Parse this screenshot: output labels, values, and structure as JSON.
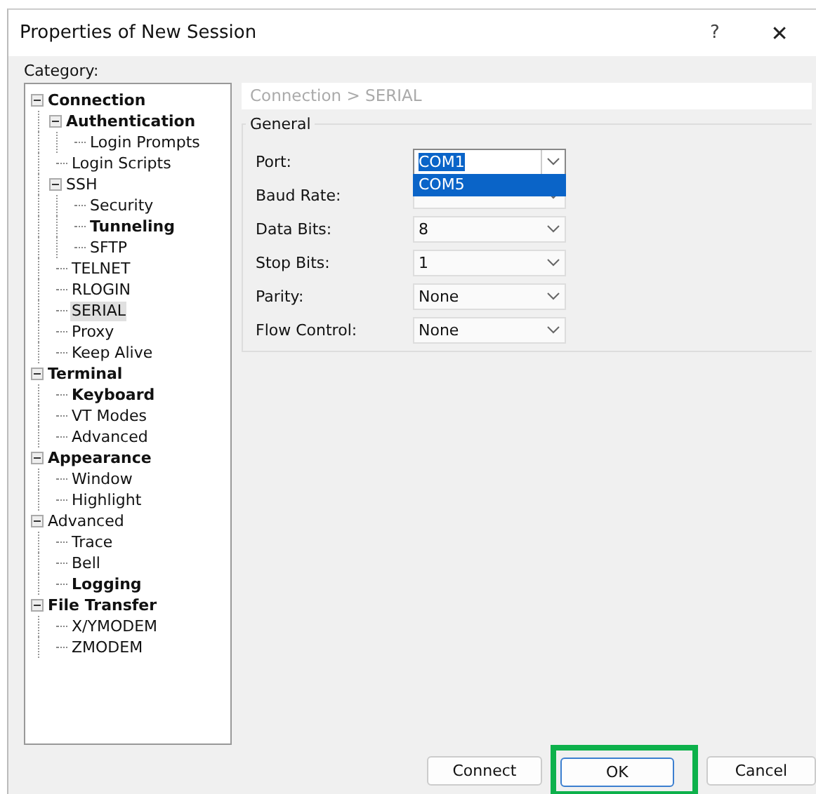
{
  "window": {
    "title": "Properties of New Session",
    "help": "?",
    "close": "✕"
  },
  "category_label": "Category:",
  "tree": [
    {
      "label": "Connection",
      "bold": true,
      "selected": false,
      "expanded": true,
      "children": [
        {
          "label": "Authentication",
          "bold": true,
          "selected": false,
          "expanded": true,
          "children": [
            {
              "label": "Login Prompts",
              "bold": false,
              "selected": false
            }
          ]
        },
        {
          "label": "Login Scripts",
          "bold": false,
          "selected": false
        },
        {
          "label": "SSH",
          "bold": false,
          "selected": false,
          "expanded": true,
          "children": [
            {
              "label": "Security",
              "bold": false,
              "selected": false
            },
            {
              "label": "Tunneling",
              "bold": true,
              "selected": false
            },
            {
              "label": "SFTP",
              "bold": false,
              "selected": false
            }
          ]
        },
        {
          "label": "TELNET",
          "bold": false,
          "selected": false
        },
        {
          "label": "RLOGIN",
          "bold": false,
          "selected": false
        },
        {
          "label": "SERIAL",
          "bold": false,
          "selected": true
        },
        {
          "label": "Proxy",
          "bold": false,
          "selected": false
        },
        {
          "label": "Keep Alive",
          "bold": false,
          "selected": false
        }
      ]
    },
    {
      "label": "Terminal",
      "bold": true,
      "selected": false,
      "expanded": true,
      "children": [
        {
          "label": "Keyboard",
          "bold": true,
          "selected": false
        },
        {
          "label": "VT Modes",
          "bold": false,
          "selected": false
        },
        {
          "label": "Advanced",
          "bold": false,
          "selected": false
        }
      ]
    },
    {
      "label": "Appearance",
      "bold": true,
      "selected": false,
      "expanded": true,
      "children": [
        {
          "label": "Window",
          "bold": false,
          "selected": false
        },
        {
          "label": "Highlight",
          "bold": false,
          "selected": false
        }
      ]
    },
    {
      "label": "Advanced",
      "bold": false,
      "selected": false,
      "expanded": true,
      "children": [
        {
          "label": "Trace",
          "bold": false,
          "selected": false
        },
        {
          "label": "Bell",
          "bold": false,
          "selected": false
        },
        {
          "label": "Logging",
          "bold": true,
          "selected": false
        }
      ]
    },
    {
      "label": "File Transfer",
      "bold": true,
      "selected": false,
      "expanded": true,
      "children": [
        {
          "label": "X/YMODEM",
          "bold": false,
          "selected": false
        },
        {
          "label": "ZMODEM",
          "bold": false,
          "selected": false
        }
      ]
    }
  ],
  "breadcrumb": "Connection > SERIAL",
  "group_title": "General",
  "fields": [
    {
      "label": "Port:",
      "value": "COM1",
      "open": true,
      "options": [
        {
          "label": "COM5",
          "selected": true
        }
      ]
    },
    {
      "label": "Baud Rate:",
      "open": false
    },
    {
      "label": "Data Bits:",
      "value": "8",
      "open": false
    },
    {
      "label": "Stop Bits:",
      "value": "1",
      "open": false
    },
    {
      "label": "Parity:",
      "value": "None",
      "open": false
    },
    {
      "label": "Flow Control:",
      "value": "None",
      "open": false
    }
  ],
  "buttons": [
    {
      "label": "Connect",
      "default": false,
      "highlighted": false
    },
    {
      "label": "OK",
      "default": true,
      "highlighted": true
    },
    {
      "label": "Cancel",
      "default": false,
      "highlighted": false
    }
  ]
}
